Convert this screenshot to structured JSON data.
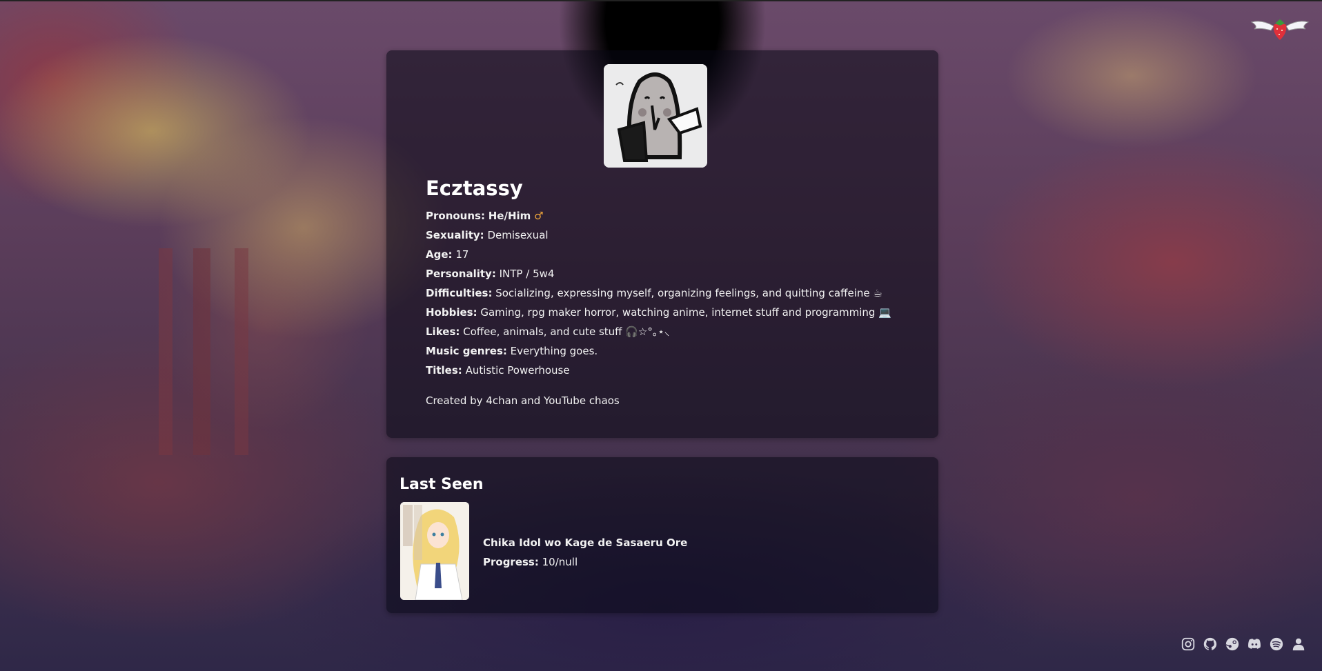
{
  "profile": {
    "name": "Ecztassy",
    "pronouns": {
      "label": "Pronouns:",
      "value": "He/Him",
      "symbol": "♂"
    },
    "fields": [
      {
        "label": "Sexuality:",
        "value": "Demisexual"
      },
      {
        "label": "Age:",
        "value": "17"
      },
      {
        "label": "Personality:",
        "value": "INTP / 5w4"
      },
      {
        "label": "Difficulties:",
        "value": "Socializing, expressing myself, organizing feelings, and quitting caffeine ☕"
      },
      {
        "label": "Hobbies:",
        "value": "Gaming, rpg maker horror, watching anime, internet stuff and programming 💻"
      },
      {
        "label": "Likes:",
        "value": "Coffee, animals, and cute stuff 🎧☆°｡⋆⸜"
      },
      {
        "label": "Music genres:",
        "value": "Everything goes."
      },
      {
        "label": "Titles:",
        "value": "Autistic Powerhouse"
      }
    ],
    "credit": "Created by 4chan and YouTube chaos"
  },
  "last_seen": {
    "title": "Last Seen",
    "item_title": "Chika Idol wo Kage de Sasaeru Ore",
    "progress_label": "Progress:",
    "progress_value": "10/null"
  },
  "socials": [
    {
      "icon": "instagram-icon"
    },
    {
      "icon": "github-icon"
    },
    {
      "icon": "steam-icon"
    },
    {
      "icon": "discord-icon"
    },
    {
      "icon": "spotify-icon"
    },
    {
      "icon": "user-icon"
    }
  ],
  "colors": {
    "accent_mars": "#f0a63a",
    "card_bg": "rgba(8,8,20,0.55)"
  }
}
